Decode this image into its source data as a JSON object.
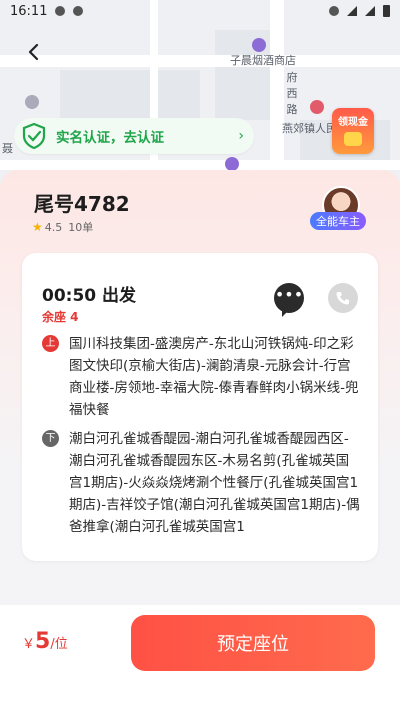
{
  "status_bar": {
    "time": "16:11"
  },
  "map": {
    "labels": [
      "子晨烟酒商店",
      "府西路",
      "燕郊镇人民",
      "聂"
    ]
  },
  "verify": {
    "text": "实名认证，去认证",
    "arrow": "›"
  },
  "cash_badge": {
    "label": "领现金"
  },
  "driver": {
    "name": "尾号4782",
    "rating": "4.5",
    "orders": "10单",
    "badge": "全能车主"
  },
  "trip": {
    "depart_time": "00:50 出发",
    "seats_left": "余座 4",
    "pickup_tag": "上",
    "pickup": "国川科技集团-盛澳房产-东北山河铁锅炖-印之彩图文快印(京榆大街店)-澜韵清泉-元脉会计-行宫商业楼-房领地-幸福大院-傣青春鲜肉小锅米线-兜福快餐",
    "dropoff_tag": "下",
    "dropoff": "潮白河孔雀城香醍园-潮白河孔雀城香醍园西区-潮白河孔雀城香醍园东区-木易名剪(孔雀城英国宫1期店)-火焱焱烧烤涮个性餐厅(孔雀城英国宫1期店)-吉祥饺子馆(潮白河孔雀城英国宫1期店)-偶爸推拿(潮白河孔雀城英国宫1"
  },
  "footer": {
    "currency": "￥",
    "price": "5",
    "unit": "/位",
    "book_label": "预定座位"
  },
  "colors": {
    "accent": "#ff5145",
    "verify_green": "#1fa54a"
  }
}
